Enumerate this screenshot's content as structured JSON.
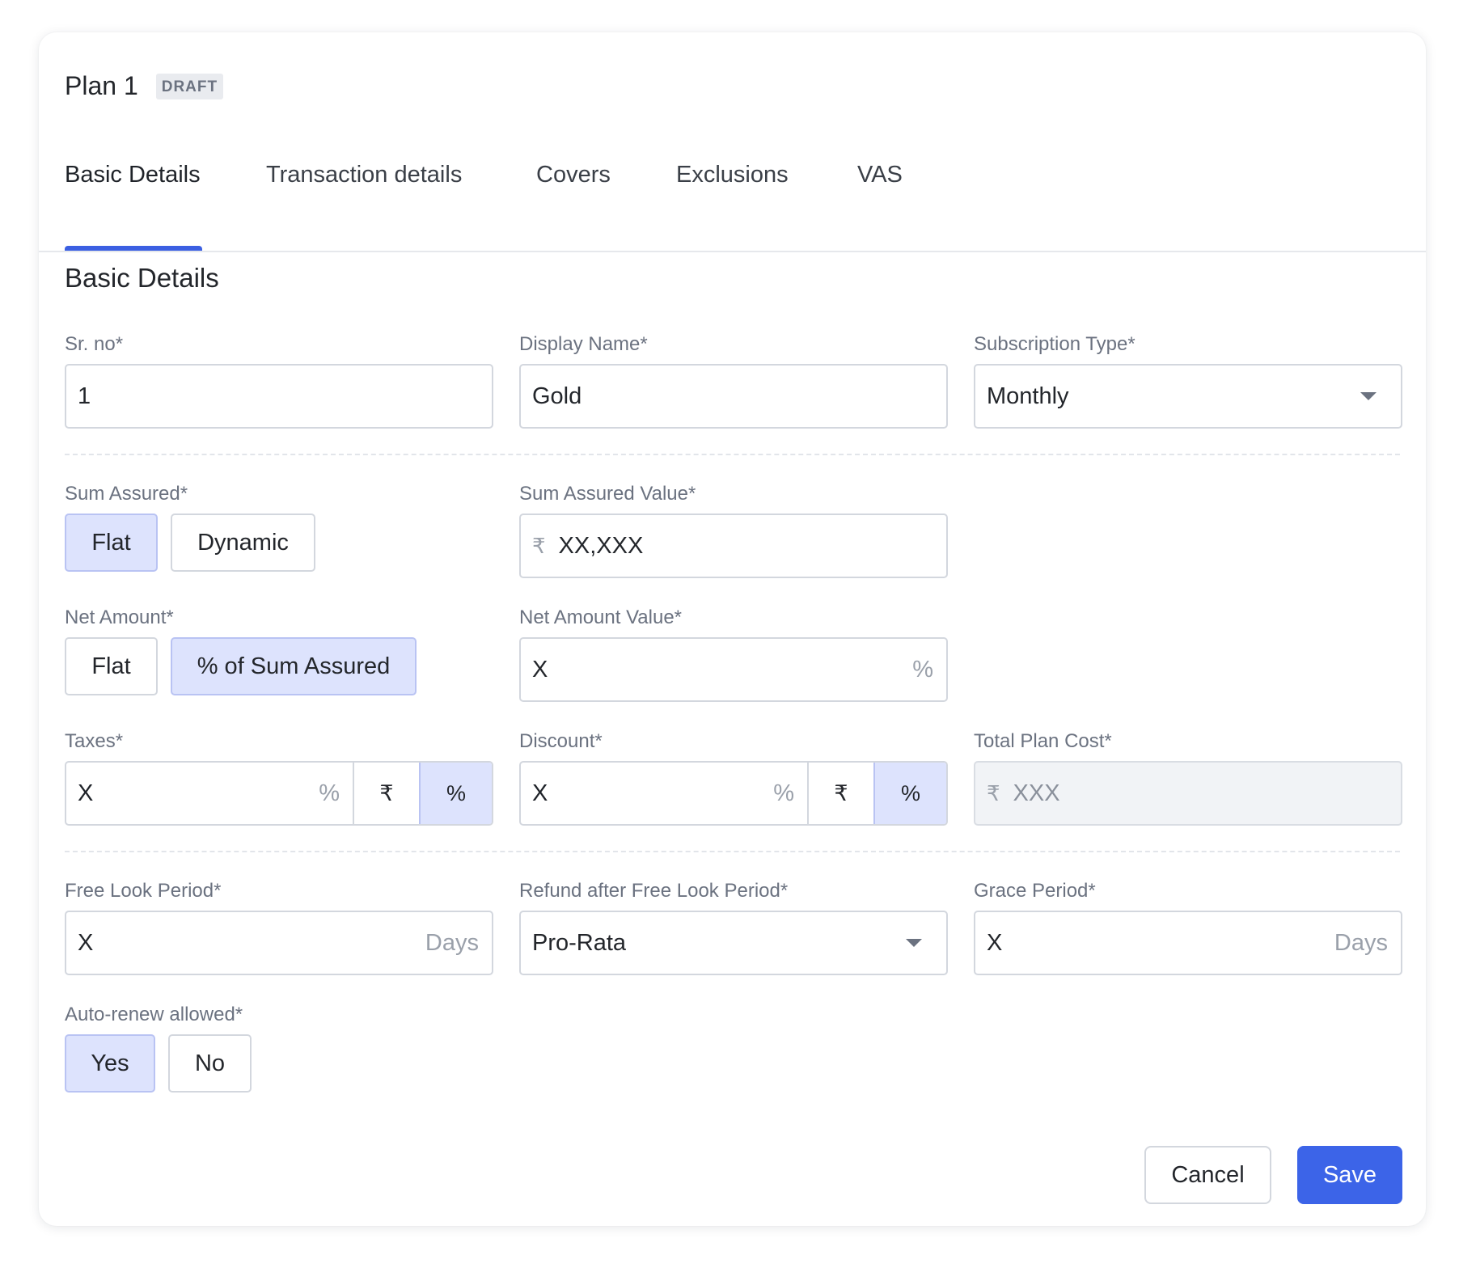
{
  "header": {
    "title": "Plan 1",
    "badge": "DRAFT"
  },
  "tabs": [
    {
      "label": "Basic Details",
      "active": true
    },
    {
      "label": "Transaction details",
      "active": false
    },
    {
      "label": "Covers",
      "active": false
    },
    {
      "label": "Exclusions",
      "active": false
    },
    {
      "label": "VAS",
      "active": false
    }
  ],
  "section": {
    "title": "Basic Details"
  },
  "fields": {
    "sr_no": {
      "label": "Sr. no*",
      "value": "1"
    },
    "display_name": {
      "label": "Display Name*",
      "value": "Gold"
    },
    "subscription_type": {
      "label": "Subscription Type*",
      "value": "Monthly"
    },
    "sum_assured": {
      "label": "Sum Assured*",
      "options": [
        "Flat",
        "Dynamic"
      ],
      "selected": "Flat"
    },
    "sum_assured_value": {
      "label": "Sum Assured Value*",
      "prefix": "₹",
      "value": "XX,XXX"
    },
    "net_amount": {
      "label": "Net Amount*",
      "options": [
        "Flat",
        "% of Sum Assured"
      ],
      "selected": "% of Sum Assured"
    },
    "net_amount_value": {
      "label": "Net Amount Value*",
      "value": "X",
      "suffix": "%"
    },
    "taxes": {
      "label": "Taxes*",
      "value": "X",
      "suffix": "%",
      "units": [
        "₹",
        "%"
      ],
      "selected_unit": "%"
    },
    "discount": {
      "label": "Discount*",
      "value": "X",
      "suffix": "%",
      "units": [
        "₹",
        "%"
      ],
      "selected_unit": "%"
    },
    "total_plan_cost": {
      "label": "Total Plan Cost*",
      "prefix": "₹",
      "value": "XXX"
    },
    "free_look_period": {
      "label": "Free Look Period*",
      "value": "X",
      "suffix": "Days"
    },
    "refund_after_free_look": {
      "label": "Refund after Free Look Period*",
      "value": "Pro-Rata"
    },
    "grace_period": {
      "label": "Grace Period*",
      "value": "X",
      "suffix": "Days"
    },
    "auto_renew": {
      "label": "Auto-renew allowed*",
      "options": [
        "Yes",
        "No"
      ],
      "selected": "Yes"
    }
  },
  "actions": {
    "cancel": "Cancel",
    "save": "Save"
  },
  "colors": {
    "accent": "#3c64e8",
    "selected_bg": "#dde3fd",
    "border": "#d3d7de",
    "label": "#6b7280"
  }
}
